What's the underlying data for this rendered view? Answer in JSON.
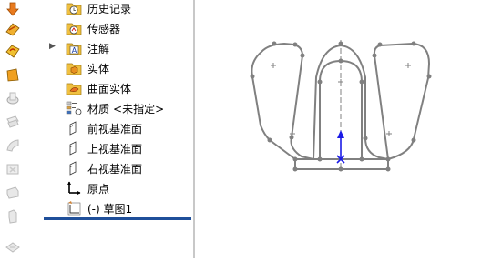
{
  "toolbar": {
    "icons": [
      "down-arrow-icon",
      "sketch-smart-dimension-icon",
      "sketch-relation-icon",
      "extrude-boss-icon",
      "revolve-icon",
      "sweep-icon",
      "loft-icon",
      "cut-icon",
      "fillet-icon",
      "pattern-icon",
      "rib-icon",
      "draft-icon"
    ]
  },
  "tree": {
    "items": [
      {
        "label": "历史记录",
        "icon": "history-folder-icon",
        "expandable": false
      },
      {
        "label": "传感器",
        "icon": "sensor-folder-icon",
        "expandable": false
      },
      {
        "label": "注解",
        "icon": "annotation-folder-icon",
        "expandable": true
      },
      {
        "label": "实体",
        "icon": "solid-bodies-folder-icon",
        "expandable": false
      },
      {
        "label": "曲面实体",
        "icon": "surface-bodies-folder-icon",
        "expandable": false
      },
      {
        "label": "材质",
        "suffix": "<未指定>",
        "icon": "material-icon",
        "expandable": false
      },
      {
        "label": "前视基准面",
        "icon": "plane-icon",
        "expandable": false
      },
      {
        "label": "上视基准面",
        "icon": "plane-icon",
        "expandable": false
      },
      {
        "label": "右视基准面",
        "icon": "plane-icon",
        "expandable": false
      },
      {
        "label": "原点",
        "icon": "origin-icon",
        "expandable": false
      },
      {
        "label": "(-) 草图1",
        "icon": "sketch-icon",
        "expandable": false
      }
    ]
  },
  "colors": {
    "sketch_line": "#808080",
    "origin": "#1a1ae6",
    "rollback_bar": "#1f4f9a",
    "folder_yellow": "#f0c040"
  }
}
